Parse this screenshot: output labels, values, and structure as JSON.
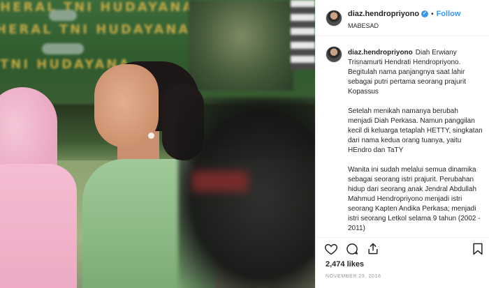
{
  "post": {
    "username": "diaz.hendropriyono",
    "separator": "•",
    "follow_label": "Follow",
    "location": "MABESAD",
    "caption": {
      "username": "diaz.hendropriyono",
      "paragraphs": [
        "Diah Erwiany Trisnamurti Hendrati Hendropriyono. Begitulah nama panjangnya saat lahir sebagai putri pertama seorang prajurit Kopassus",
        "Setelah menikah namanya berubah menjadi Diah Perkasa. Namun panggilan kecil di keluarga tetaplah HETTY, singkatan dari nama kedua orang tuanya, yaitu HEndro dan TaTY",
        "Wanita ini sudah melalui semua dinamika sebagai seorang istri prajurit. Perubahan hidup dari seorang anak Jendral Abdullah Mahmud Hendropriyono menjadi istri seorang Kapten Andika Perkasa; menjadi istri seorang Letkol selama 9 tahun (2002 - 2011)"
      ]
    },
    "likes": "2,474 likes",
    "date": "NOVEMBER 29, 2018"
  },
  "photo": {
    "banner_rows": [
      "HERAL  TNI  HUDAYANA",
      "HERAL  TNI  HUDAYANA",
      "TNI  HUDAYANA"
    ]
  },
  "icons": {
    "verified": "verified-badge-icon",
    "like": "heart-icon",
    "comment": "comment-icon",
    "share": "share-icon",
    "save": "bookmark-icon"
  },
  "colors": {
    "accent": "#3897f0",
    "text": "#262626",
    "muted": "#999999"
  }
}
